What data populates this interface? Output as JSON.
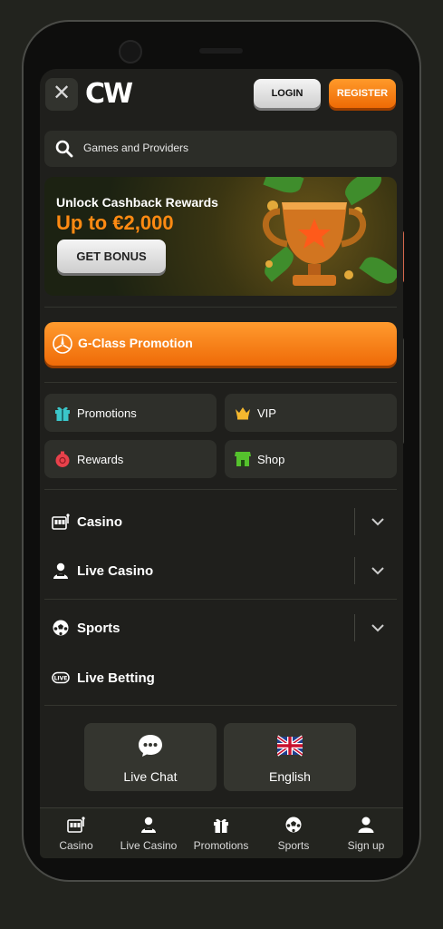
{
  "header": {
    "logo_text": "CW",
    "login_label": "LOGIN",
    "register_label": "REGISTER"
  },
  "search": {
    "placeholder": "Games and Providers"
  },
  "banner": {
    "title": "Unlock Cashback Rewards",
    "amount": "Up to €2,000",
    "cta": "GET BONUS"
  },
  "promo_bar": {
    "label": "G-Class Promotion"
  },
  "quick_links": [
    {
      "label": "Promotions",
      "icon": "gift-icon"
    },
    {
      "label": "VIP",
      "icon": "crown-icon"
    },
    {
      "label": "Rewards",
      "icon": "reward-icon"
    },
    {
      "label": "Shop",
      "icon": "shop-icon"
    }
  ],
  "menu": [
    {
      "label": "Casino",
      "icon": "slot-machine-icon",
      "expandable": true
    },
    {
      "label": "Live Casino",
      "icon": "dealer-icon",
      "expandable": true
    },
    {
      "label": "Sports",
      "icon": "soccer-ball-icon",
      "expandable": true
    },
    {
      "label": "Live Betting",
      "icon": "live-icon",
      "expandable": false
    }
  ],
  "help": {
    "chat_label": "Live Chat",
    "language_label": "English"
  },
  "bottom_nav": [
    {
      "label": "Casino",
      "icon": "slot-machine-icon"
    },
    {
      "label": "Live Casino",
      "icon": "dealer-icon"
    },
    {
      "label": "Promotions",
      "icon": "gift-icon"
    },
    {
      "label": "Sports",
      "icon": "soccer-ball-icon"
    },
    {
      "label": "Sign up",
      "icon": "user-icon"
    }
  ],
  "colors": {
    "accent": "#f57a12",
    "background": "#1f1f1c",
    "tile": "#2e2f2a",
    "gift": "#3bc6c9",
    "crown": "#f5b82e",
    "reward": "#e8414b",
    "shop": "#55c22d"
  }
}
